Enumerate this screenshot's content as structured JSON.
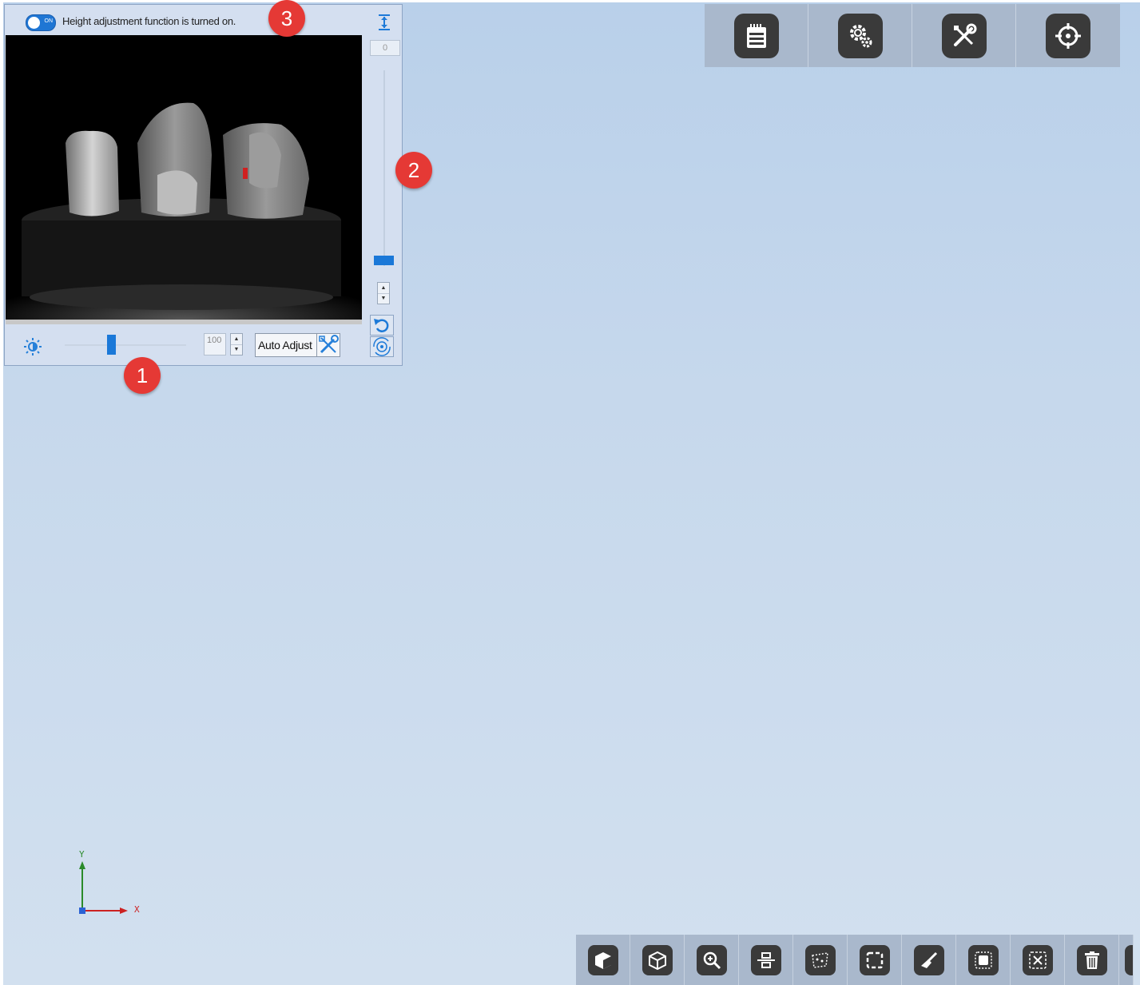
{
  "camera_panel": {
    "toggle_label": "ON",
    "status_text": "Height adjustment function is turned on.",
    "brightness_value": "100",
    "brightness_level": 0.38,
    "auto_adjust_label": "Auto Adjust",
    "height_value": "0",
    "height_level": 0.03
  },
  "callouts": [
    "1",
    "2",
    "3"
  ],
  "top_toolbar": {
    "buttons": [
      {
        "name": "notepad-icon"
      },
      {
        "name": "settings-gear-icon"
      },
      {
        "name": "tools-icon"
      },
      {
        "name": "crosshair-icon"
      }
    ]
  },
  "bottom_toolbar": {
    "buttons": [
      {
        "name": "solid-view-icon"
      },
      {
        "name": "wireframe-view-icon"
      },
      {
        "name": "zoom-in-icon"
      },
      {
        "name": "align-center-icon"
      },
      {
        "name": "lasso-select-icon"
      },
      {
        "name": "rectangle-select-icon"
      },
      {
        "name": "brush-icon"
      },
      {
        "name": "select-all-icon"
      },
      {
        "name": "deselect-icon"
      },
      {
        "name": "trash-icon"
      }
    ]
  },
  "axes": {
    "x_label": "X",
    "y_label": "Y"
  },
  "colors": {
    "accent": "#1a78d8",
    "callout": "#e53935",
    "toolbar": "#a9b8cc",
    "icon_tile": "#3a3a3a"
  }
}
